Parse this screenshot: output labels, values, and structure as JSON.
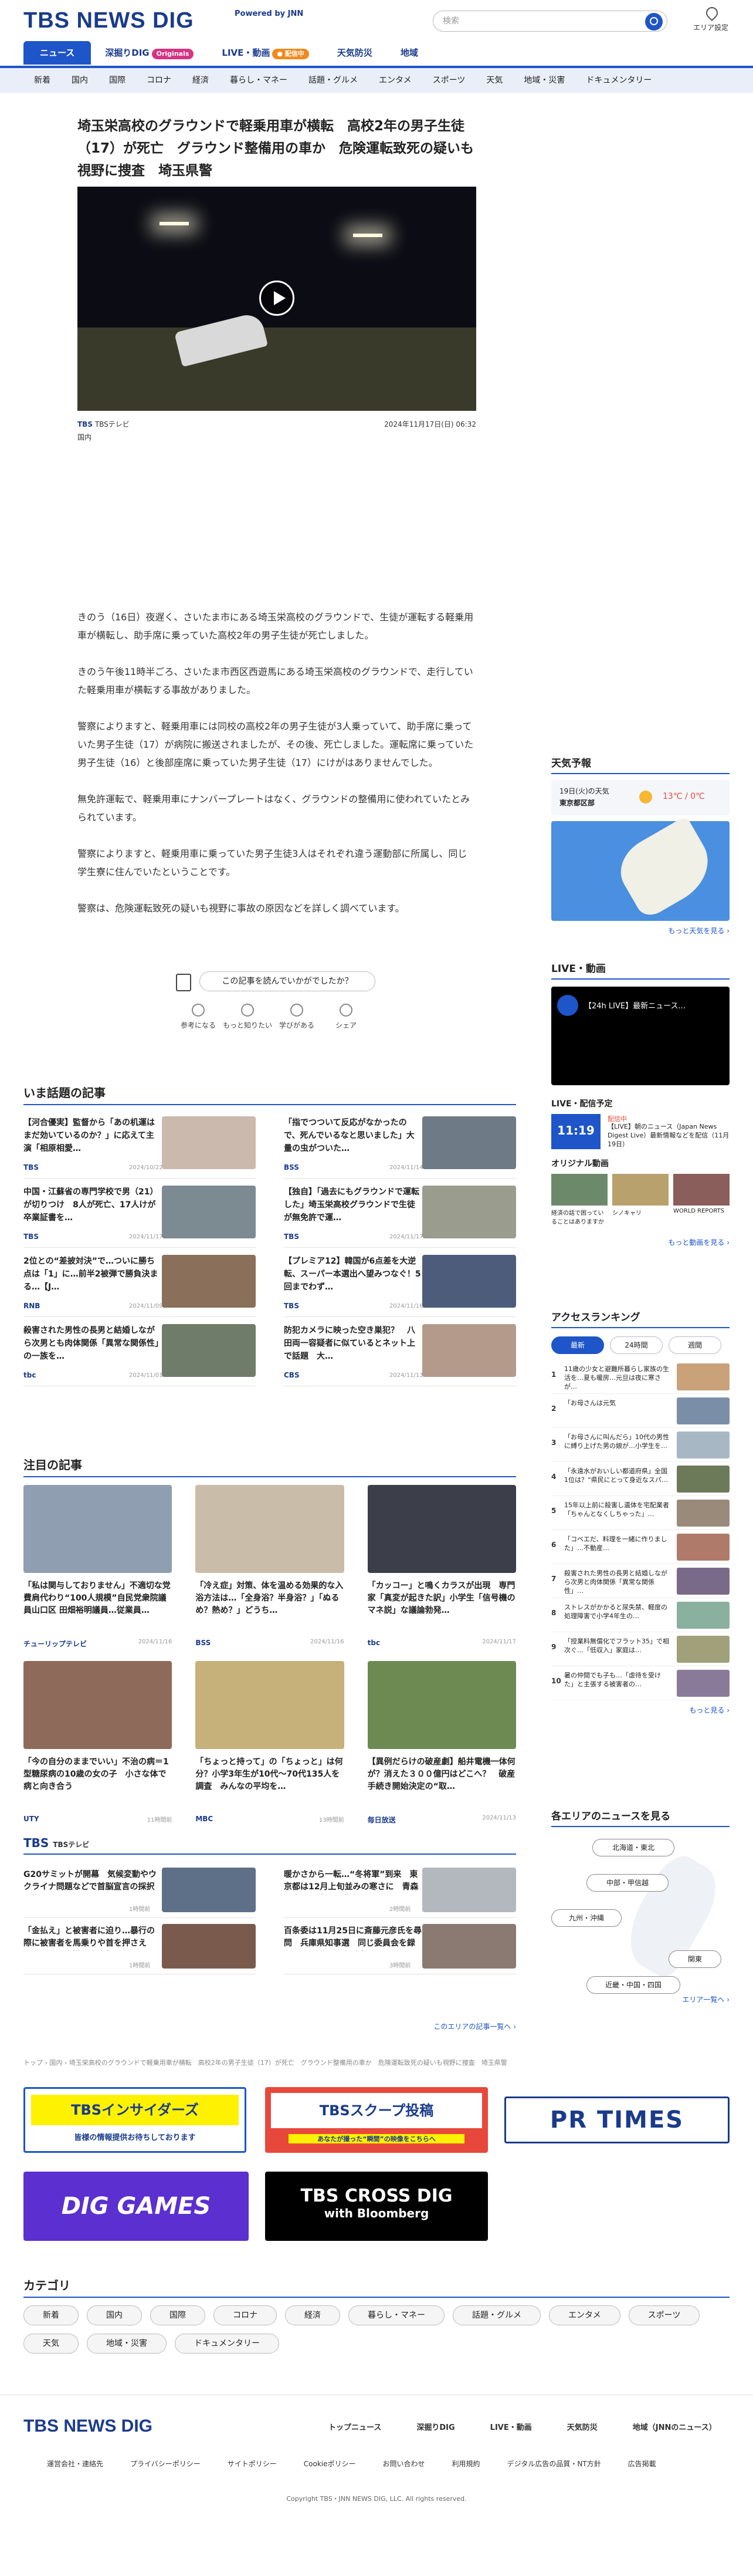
{
  "header": {
    "logo": "TBS NEWS DIG",
    "powered": "Powered by JNN",
    "search_placeholder": "検索",
    "area_label": "エリア設定"
  },
  "topnav": [
    {
      "label": "ニュース",
      "badge": ""
    },
    {
      "label": "深掘りDIG",
      "badge": "Originals"
    },
    {
      "label": "LIVE・動画",
      "badge": "● 配信中"
    },
    {
      "label": "天気防災",
      "badge": ""
    },
    {
      "label": "地域",
      "badge": ""
    }
  ],
  "categories": [
    "新着",
    "国内",
    "国際",
    "コロナ",
    "経済",
    "暮らし・マネー",
    "話題・グルメ",
    "エンタメ",
    "スポーツ",
    "天気",
    "地域・災害",
    "ドキュメンタリー"
  ],
  "article": {
    "title": "埼玉栄高校のグラウンドで軽乗用車が横転　高校2年の男子生徒（17）が死亡　グラウンド整備用の車か　危険運転致死の疑いも視野に捜査　埼玉県警",
    "source_logo": "TBS",
    "source": "TBSテレビ",
    "date": "2024年11月17日(日) 06:32",
    "category": "国内",
    "paragraphs": [
      "きのう（16日）夜遅く、さいたま市にある埼玉栄高校のグラウンドで、生徒が運転する軽乗用車が横転し、助手席に乗っていた高校2年の男子生徒が死亡しました。",
      "きのう午後11時半ごろ、さいたま市西区西遊馬にある埼玉栄高校のグラウンドで、走行していた軽乗用車が横転する事故がありました。",
      "警察によりますと、軽乗用車には同校の高校2年の男子生徒が3人乗っていて、助手席に乗っていた男子生徒（17）が病院に搬送されましたが、その後、死亡しました。運転席に乗っていた男子生徒（16）と後部座席に乗っていた男子生徒（17）にけがはありませんでした。",
      "無免許運転で、軽乗用車にナンバープレートはなく、グラウンドの整備用に使われていたとみられています。",
      "警察によりますと、軽乗用車に乗っていた男子生徒3人はそれぞれ違う運動部に所属し、同じ学生寮に住んでいたということです。",
      "警察は、危険運転致死の疑いも視野に事故の原因などを詳しく調べています。"
    ]
  },
  "feedback": {
    "question": "この記事を読んでいかがでしたか？",
    "reactions": [
      "参考になる",
      "もっと知りたい",
      "学びがある",
      "シェア"
    ]
  },
  "hot": {
    "title": "いま話題の記事",
    "items": [
      {
        "title": "【河合優実】監督から「あの机運はまだ効いているのか？」に応えて主演「相原相愛…",
        "source": "TBS",
        "date": "2024/10/22"
      },
      {
        "title": "「指でつついて反応がなかったので、死んでいるなと思いました」大量の虫がついた…",
        "source": "BSS",
        "date": "2024/11/14"
      },
      {
        "title": "中国・江蘇省の専門学校で男（21）が切りつけ　8人が死亡、17人けが　卒業証書を…",
        "source": "TBS",
        "date": "2024/11/17"
      },
      {
        "title": "【独自】「過去にもグラウンドで運転した」埼玉栄高校グラウンドで生徒が無免許で運…",
        "source": "TBS",
        "date": "2024/11/17"
      },
      {
        "title": "2位との“差披対決”で…ついに勝ち点は「1」に…前半2被弾で勝負決まる…【J…",
        "source": "RNB",
        "date": "2024/11/09"
      },
      {
        "title": "【プレミア12】韓国が6点差を大逆転、スーパー本選出へ望みつなぐ！5回までわず…",
        "source": "TBS",
        "date": "2024/11/16"
      },
      {
        "title": "殺害された男性の長男と結婚しながら次男とも肉体関係「異常な関係性」の一族を…",
        "source": "tbc",
        "date": "2024/11/01"
      },
      {
        "title": "防犯カメラに映った空き巣犯？　八田両一容疑者に似ているとネット上で話題　大…",
        "source": "CBS",
        "date": "2024/11/13"
      }
    ]
  },
  "featured": {
    "title": "注目の記事",
    "items": [
      {
        "title": "「私は関与しておりません」不適切な党費肩代わり“100人規模”自民党衆院議員山口区 田畑裕明議員…従業員…",
        "source": "チューリップテレビ",
        "date": "2024/11/16"
      },
      {
        "title": "「冷え症」対策、体を温める効果的な入浴方法は…「全身浴？半身浴？」「ぬるめ？熱め？」どうち…",
        "source": "BSS",
        "date": "2024/11/16"
      },
      {
        "title": "「カッコー」と鳴くカラスが出現　専門家「真変が起きた訳」小学生「信号機のマネ説」な議論勃発…",
        "source": "tbc",
        "date": "2024/11/17"
      },
      {
        "title": "「今の自分のままでいい」不治の病＝1型糖尿病の10歳の女の子　小さな体で病と向き合う",
        "source": "UTY",
        "date": "11時間前"
      },
      {
        "title": "「ちょっと持って」の「ちょっと」は何分？小学3年生が10代〜70代135人を調査　みんなの平均を…",
        "source": "MBC",
        "date": "13時間前"
      },
      {
        "title": "【異例だらけの破産劇】船井電機一体何が？消えた３００億円はどこへ？　破産手続き開始決定の“取…",
        "source": "毎日放送",
        "date": "2024/11/13"
      }
    ]
  },
  "local": {
    "title_logo": "TBS",
    "title": "TBSテレビ",
    "items": [
      {
        "title": "G20サミットが開幕　気候変動やウクライナ問題などで首脳宣言の採択目指す",
        "date": "1時間前"
      },
      {
        "title": "暖かさから一転…“冬将軍”到来　東京都は12月上旬並みの寒さに　青森県内では積雪で道路…",
        "date": "2時間前"
      },
      {
        "title": "「金払え」と被害者に迫り…暴行の際に被害者を馬乗りや首を押さえ　強盗などの容疑で交際相手の…",
        "date": "1時間前"
      },
      {
        "title": "百条委は11月25日に斎藤元彦氏を尋問　兵庫県知事選　同じ委員会を録画ありでもやり方が違…",
        "date": "3時間前"
      }
    ],
    "more": "このエリアの記事一覧へ ›"
  },
  "breadcrumb": "トップ › 国内 › 埼玉栄高校のグラウンドで軽乗用車が横転　高校2年の男子生徒（17）が死亡　グラウンド整備用の車か　危険運転致死の疑いも視野に捜査　埼玉県警",
  "banners": [
    {
      "title": "TBSインサイダーズ",
      "sub": "皆様の情報提供お待ちしております"
    },
    {
      "title": "TBSスクープ投稿",
      "sub": "あなたが撮った“瞬間”の映像をこちらへ"
    },
    {
      "title": "PR TIMES",
      "sub": ""
    },
    {
      "title": "DIG GAMES",
      "sub": ""
    },
    {
      "title": "TBS CROSS DIG",
      "sub": "with Bloomberg"
    }
  ],
  "catsection": {
    "title": "カテゴリ",
    "items": [
      "新着",
      "国内",
      "国際",
      "コロナ",
      "経済",
      "暮らし・マネー",
      "話題・グルメ",
      "エンタメ",
      "スポーツ",
      "天気",
      "地域・災害",
      "ドキュメンタリー"
    ]
  },
  "sidebar": {
    "weather_title": "天気予報",
    "weather_date": "19日(火)の天気",
    "weather_place": "東京都区部",
    "weather_temp": "13℃ / 0℃",
    "weather_more": "もっと天気を見る ›",
    "live_title": "LIVE・動画",
    "live_video": "【24h LIVE】最新ニュース...",
    "schedule_title": "LIVE・配信予定",
    "schedule_label": "配信中",
    "schedule_time": "11:19",
    "schedule_text": "【LIVE】朝のニュース（Japan News Digest Live）最新情報などを配信（11月19日）",
    "originals_title": "オリジナル動画",
    "originals": [
      "経済の話で困っていることはありますか",
      "シノキャリ",
      "WORLD REPORTS"
    ],
    "originals_more": "もっと動画を見る ›",
    "ranking_title": "アクセスランキング",
    "ranking_tabs": [
      "最新",
      "24時間",
      "週間"
    ],
    "ranking": [
      "11歳の少女と避難所暮らし家族の生活を…夏も暖房…元旦は夜に寒さが…",
      "「お母さんは元気",
      "「お母さんに叫んだら」10代の男性に縛り上げた男の娘が…小学生を…",
      "「永遠水がおいしい都道府県」全国1位は？“県民にとって身近なスパ…",
      "15年以上前に殺害し遺体を宅配業者「ちゃんとなくしちゃった」…",
      "「コベエだ、料理を一緒に作りました」…不動産…",
      "殺害された男性の長男と結婚しながら次男と肉体関係「異常な関係性」…",
      "ストレスがかかると尿失禁、軽度の処理障害で小学4年生の…",
      "「授業料無償化でフラット35」で相次ぐ…「低収入」家庭は…",
      "暑の仲間でも子も…「虐待を受けた」と主張する被害者の…"
    ],
    "ranking_more": "もっと見る ›",
    "areas_title": "各エリアのニュースを見る",
    "areas": [
      "北海道・東北",
      "中部・甲信越",
      "九州・沖縄",
      "関東",
      "近畿・中国・四国"
    ],
    "areas_more": "エリア一覧へ ›"
  },
  "footer": {
    "logo": "TBS NEWS DIG",
    "top": [
      "トップニュース",
      "深掘りDIG",
      "LIVE・動画",
      "天気防災",
      "地域（JNNのニュース）"
    ],
    "links": [
      "運営会社・連絡先",
      "プライバシーポリシー",
      "サイトポリシー",
      "Cookieポリシー",
      "お問い合わせ",
      "利用規約",
      "デジタル広告の品質・NT方針",
      "広告掲載"
    ],
    "copyright": "Copyright TBS・JNN NEWS DIG, LLC. All rights reserved."
  }
}
